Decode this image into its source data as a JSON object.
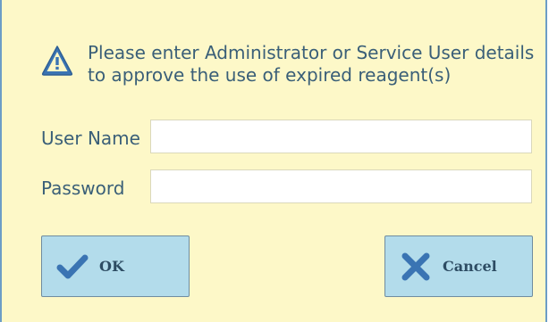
{
  "dialog": {
    "message": "Please enter Administrator or Service User details to approve the use of expired reagent(s)",
    "icon": "warning-triangle-icon"
  },
  "fields": {
    "username": {
      "label": "User Name",
      "value": "",
      "placeholder": ""
    },
    "password": {
      "label": "Password",
      "value": "",
      "placeholder": ""
    }
  },
  "buttons": {
    "ok": {
      "label": "OK",
      "icon": "checkmark-icon"
    },
    "cancel": {
      "label": "Cancel",
      "icon": "x-icon"
    }
  },
  "colors": {
    "background": "#fdf8c8",
    "text": "#3a5f78",
    "button": "#b3dceb",
    "icon": "#3a74b3",
    "border": "#6c9dc6"
  }
}
